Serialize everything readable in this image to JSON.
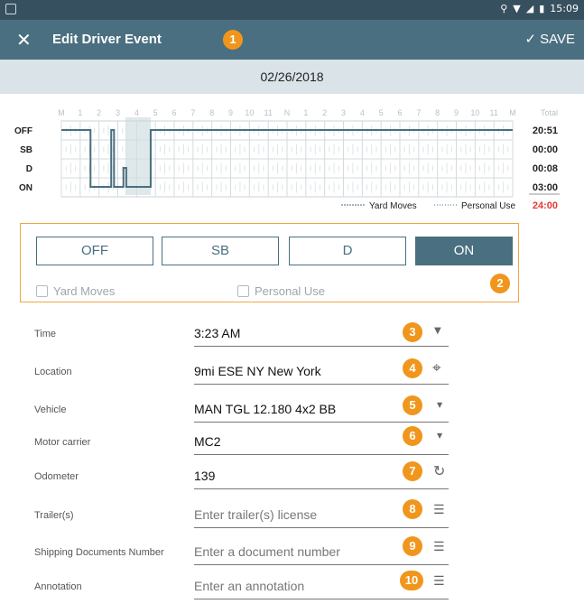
{
  "status_bar": {
    "time": "15:09"
  },
  "app_bar": {
    "title": "Edit Driver Event",
    "save_label": "SAVE",
    "close_icon": "close-icon",
    "check_icon": "check-icon"
  },
  "date": "02/26/2018",
  "chart": {
    "hour_labels": [
      "M",
      "1",
      "2",
      "3",
      "4",
      "5",
      "6",
      "7",
      "8",
      "9",
      "10",
      "11",
      "N",
      "1",
      "2",
      "3",
      "4",
      "5",
      "6",
      "7",
      "8",
      "9",
      "10",
      "11",
      "M"
    ],
    "row_labels": [
      "OFF",
      "SB",
      "D",
      "ON"
    ],
    "total_header": "Total",
    "totals": [
      "20:51",
      "00:00",
      "00:08",
      "03:00"
    ],
    "total_sum": "24:00",
    "legend_yard": "Yard Moves",
    "legend_personal": "Personal Use"
  },
  "chart_data": {
    "type": "line",
    "x_unit": "hour of day",
    "rows": [
      "OFF",
      "SB",
      "D",
      "ON"
    ],
    "segments": [
      {
        "status": "OFF",
        "start": 0.0,
        "end": 1.55
      },
      {
        "status": "ON",
        "start": 1.55,
        "end": 2.65
      },
      {
        "status": "OFF",
        "start": 2.65,
        "end": 2.8
      },
      {
        "status": "ON",
        "start": 2.8,
        "end": 3.3
      },
      {
        "status": "D",
        "start": 3.3,
        "end": 3.45
      },
      {
        "status": "ON",
        "start": 3.45,
        "end": 4.75
      },
      {
        "status": "OFF",
        "start": 4.75,
        "end": 24.0
      }
    ],
    "highlight": {
      "start": 3.4,
      "end": 4.75
    },
    "totals": {
      "OFF": "20:51",
      "SB": "00:00",
      "D": "00:08",
      "ON": "03:00",
      "sum": "24:00"
    }
  },
  "status_buttons": [
    {
      "label": "OFF",
      "active": false
    },
    {
      "label": "SB",
      "active": false
    },
    {
      "label": "D",
      "active": false
    },
    {
      "label": "ON",
      "active": true
    }
  ],
  "checkboxes": {
    "yard_moves": "Yard Moves",
    "personal_use": "Personal Use"
  },
  "fields": {
    "time": {
      "label": "Time",
      "value": "3:23 AM"
    },
    "location": {
      "label": "Location",
      "value": "9mi ESE NY New York"
    },
    "vehicle": {
      "label": "Vehicle",
      "value": "MAN TGL 12.180 4x2 BB"
    },
    "motor_carrier": {
      "label": "Motor carrier",
      "value": "MC2"
    },
    "odometer": {
      "label": "Odometer",
      "value": "139"
    },
    "trailers": {
      "label": "Trailer(s)",
      "placeholder": "Enter trailer(s) license"
    },
    "shipping": {
      "label": "Shipping Documents Number",
      "placeholder": "Enter a document number"
    },
    "annotation": {
      "label": "Annotation",
      "placeholder": "Enter an annotation"
    }
  },
  "badges": [
    "1",
    "2",
    "3",
    "4",
    "5",
    "6",
    "7",
    "8",
    "9",
    "10"
  ],
  "colors": {
    "appbar": "#4a6f80",
    "statusbar": "#36505f",
    "datebar": "#d9e3e8",
    "badge": "#f0961c",
    "highlight": "#dfe8ea",
    "total_red": "#e53935"
  }
}
